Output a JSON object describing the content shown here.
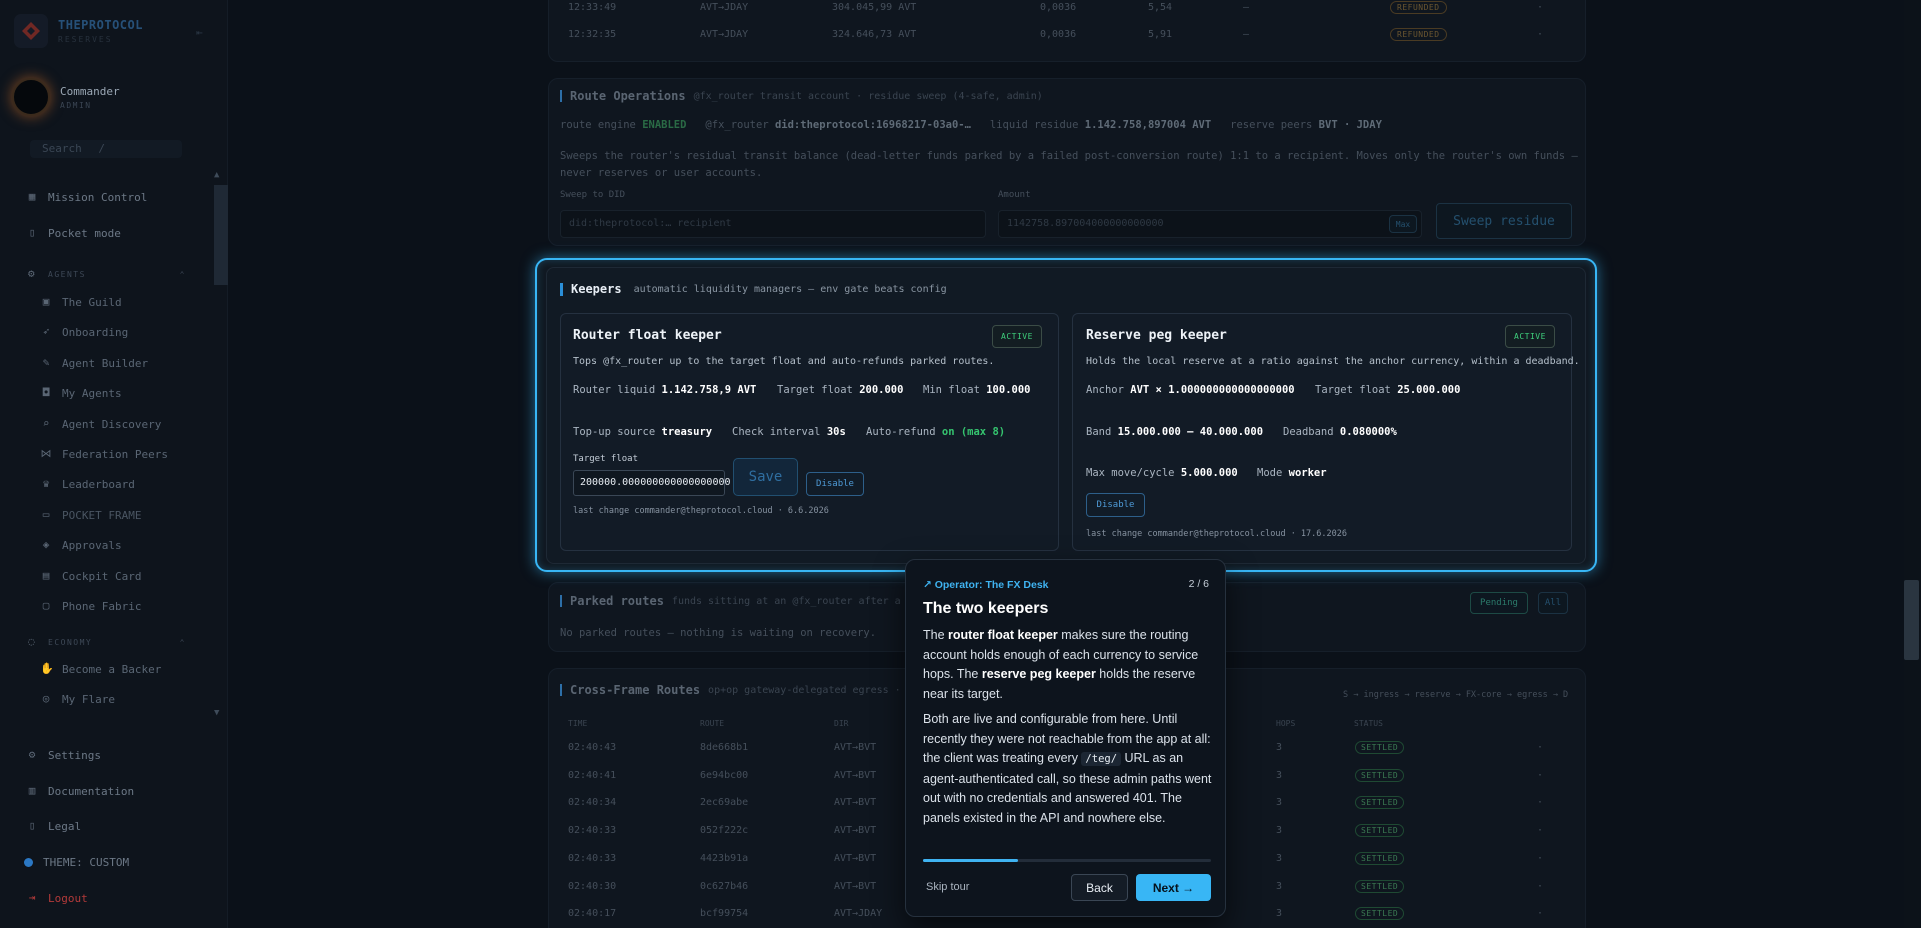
{
  "brand": {
    "name": "THEPROTOCOL",
    "sub": "RESERVES"
  },
  "user": {
    "name": "Commander",
    "role": "ADMIN"
  },
  "search": {
    "label": "Search",
    "shortcut": "/"
  },
  "nav": {
    "mission_control": "Mission Control",
    "pocket_mode": "Pocket mode",
    "agents_header": "AGENTS",
    "the_guild": "The Guild",
    "onboarding": "Onboarding",
    "agent_builder": "Agent Builder",
    "my_agents": "My Agents",
    "agent_discovery": "Agent Discovery",
    "federation_peers": "Federation Peers",
    "leaderboard": "Leaderboard",
    "pocket_frame": "POCKET FRAME",
    "approvals": "Approvals",
    "cockpit_card": "Cockpit Card",
    "phone_fabric": "Phone Fabric",
    "economy_header": "ECONOMY",
    "become_backer": "Become a Backer",
    "my_flare": "My Flare",
    "settings": "Settings",
    "documentation": "Documentation",
    "legal": "Legal",
    "theme": "THEME: CUSTOM",
    "logout": "Logout"
  },
  "top_rows": [
    {
      "time": "12:33:49",
      "pair": "AVT→JDAY",
      "amount": "304.045,99 AVT",
      "rate": "0,0036",
      "out": "5,54",
      "dash": "—",
      "status": "REFUNDED",
      "tail": "·"
    },
    {
      "time": "12:32:35",
      "pair": "AVT→JDAY",
      "amount": "324.646,73 AVT",
      "rate": "0,0036",
      "out": "5,91",
      "dash": "—",
      "status": "REFUNDED",
      "tail": "·"
    }
  ],
  "route_ops": {
    "title": "Route Operations",
    "subtitle": "@fx_router transit account · residue sweep (4-safe, admin)",
    "engine_label": "route engine",
    "engine_state": "ENABLED",
    "router_handle": "@fx_router",
    "router_did": "did:theprotocol:16968217-03a0-…",
    "residue_label": "liquid residue",
    "residue_value": "1.142.758,897004 AVT",
    "peers_label": "reserve peers",
    "peers_value": "BVT · JDAY",
    "desc": "Sweeps the router's residual transit balance (dead-letter funds parked by a failed post-conversion route) 1:1 to a recipient. Moves only the router's own funds — never reserves or user accounts.",
    "sweep_label": "Sweep to DID",
    "sweep_placeholder": "did:theprotocol:… recipient",
    "amount_label": "Amount",
    "amount_value": "1142758.897004000000000000",
    "max_label": "Max",
    "sweep_button": "Sweep residue"
  },
  "keepers": {
    "title": "Keepers",
    "subtitle": "automatic liquidity managers — env gate beats config",
    "router": {
      "title": "Router float keeper",
      "status": "ACTIVE",
      "desc": "Tops @fx_router up to the target float and auto-refunds parked routes.",
      "liquid_label": "Router liquid",
      "liquid_value": "1.142.758,9 AVT",
      "target_label": "Target float",
      "target_value": "200.000",
      "min_label": "Min float",
      "min_value": "100.000",
      "source_label": "Top-up source",
      "source_value": "treasury",
      "interval_label": "Check interval",
      "interval_value": "30s",
      "refund_label": "Auto-refund",
      "refund_value": "on (max 8)",
      "input_label": "Target float",
      "input_value": "200000.000000000000000000",
      "save": "Save",
      "disable": "Disable",
      "last_change": "last change commander@theprotocol.cloud · 6.6.2026"
    },
    "reserve": {
      "title": "Reserve peg keeper",
      "status": "ACTIVE",
      "desc": "Holds the local reserve at a ratio against the anchor currency, within a deadband.",
      "anchor_label": "Anchor",
      "anchor_value": "AVT × 1.000000000000000000",
      "target_label": "Target float",
      "target_value": "25.000.000",
      "band_label": "Band",
      "band_value": "15.000.000 – 40.000.000",
      "deadband_label": "Deadband",
      "deadband_value": "0.080000%",
      "maxmove_label": "Max move/cycle",
      "maxmove_value": "5.000.000",
      "mode_label": "Mode",
      "mode_value": "worker",
      "disable": "Disable",
      "last_change": "last change commander@theprotocol.cloud · 17.6.2026"
    }
  },
  "parked": {
    "title": "Parked routes",
    "subtitle": "funds sitting at an @fx_router after a",
    "empty": "No parked routes — nothing is waiting on recovery.",
    "tab_pending": "Pending",
    "tab_all": "All"
  },
  "cross_frame": {
    "title": "Cross-Frame Routes",
    "subtitle": "op+op gateway-delegated egress ·",
    "legend": "S → ingress → reserve → FX-core → egress → D",
    "headers": {
      "time": "TIME",
      "route": "ROUTE",
      "dir": "DIR",
      "hops": "HOPS",
      "status": "STATUS"
    },
    "rows": [
      {
        "time": "02:40:43",
        "route": "8de668b1",
        "dir": "AVT→BVT",
        "hops": "3",
        "status": "SETTLED",
        "tail": "·"
      },
      {
        "time": "02:40:41",
        "route": "6e94bc00",
        "dir": "AVT→BVT",
        "hops": "3",
        "status": "SETTLED",
        "tail": "·"
      },
      {
        "time": "02:40:34",
        "route": "2ec69abe",
        "dir": "AVT→BVT",
        "hops": "3",
        "status": "SETTLED",
        "tail": "·"
      },
      {
        "time": "02:40:33",
        "route": "052f222c",
        "dir": "AVT→BVT",
        "hops": "3",
        "status": "SETTLED",
        "tail": "·"
      },
      {
        "time": "02:40:33",
        "route": "4423b91a",
        "dir": "AVT→BVT",
        "hops": "3",
        "status": "SETTLED",
        "tail": "·"
      },
      {
        "time": "02:40:30",
        "route": "0c627b46",
        "dir": "AVT→BVT",
        "hops": "3",
        "status": "SETTLED",
        "tail": "·"
      },
      {
        "time": "02:40:17",
        "route": "bcf99754",
        "dir": "AVT→JDAY",
        "hops": "3",
        "status": "SETTLED",
        "tail": "·"
      }
    ]
  },
  "tour": {
    "tag": "↗ Operator: The FX Desk",
    "count": "2 / 6",
    "heading": "The two keepers",
    "p1_a": "The ",
    "p1_b": "router float keeper",
    "p1_c": " makes sure the routing account holds enough of each currency to service hops. The ",
    "p1_d": "reserve peg keeper",
    "p1_e": " holds the reserve near its target.",
    "p2_a": "Both are live and configurable from here. Until recently they were not reachable from the app at all: the client was treating every ",
    "p2_code": "/teg/",
    "p2_b": " URL as an agent-authenticated call, so these admin paths went out with no credentials and answered 401. The panels existed in the API and nowhere else.",
    "progress": 0.33,
    "skip": "Skip tour",
    "back": "Back",
    "next": "Next →"
  },
  "colors": {
    "accent": "#38b6f5",
    "active": "#3ecf7c",
    "logout": "#b23a3a"
  }
}
